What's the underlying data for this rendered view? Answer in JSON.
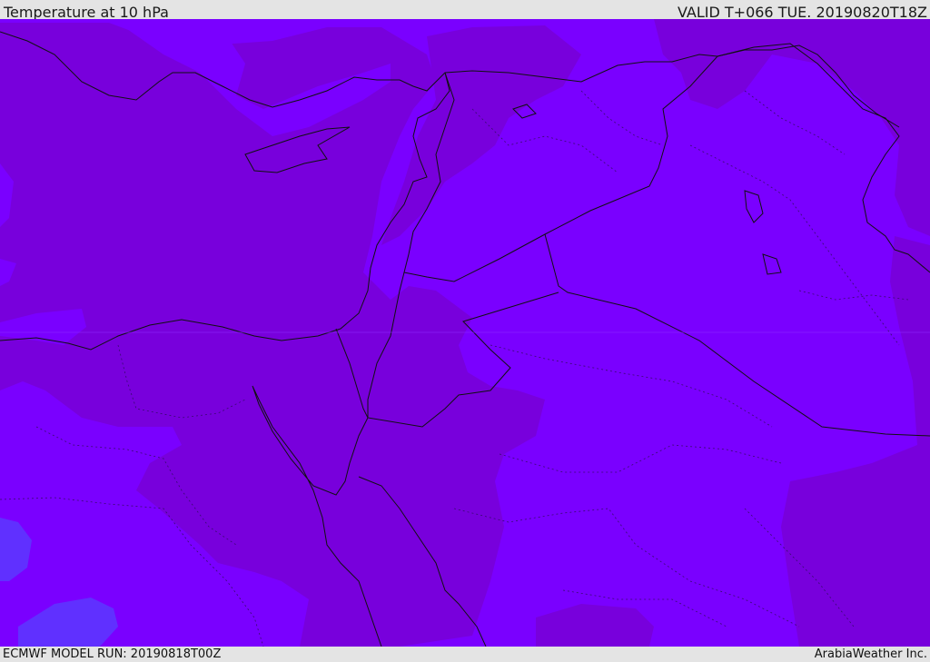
{
  "header": {
    "title": "Temperature at 10 hPa",
    "valid_time": "VALID T+066 TUE. 20190820T18Z"
  },
  "footer": {
    "model_run": "ECMWF MODEL RUN: 20190818T00Z",
    "credit": "ArabiaWeather Inc."
  },
  "colors": {
    "field_light": "#7a00ff",
    "field_dark": "#7800dc",
    "field_blue": "#6020ff",
    "borders": "#111111",
    "admin_lines": "#3a0a70",
    "bar_background": "#e4e4e4"
  }
}
